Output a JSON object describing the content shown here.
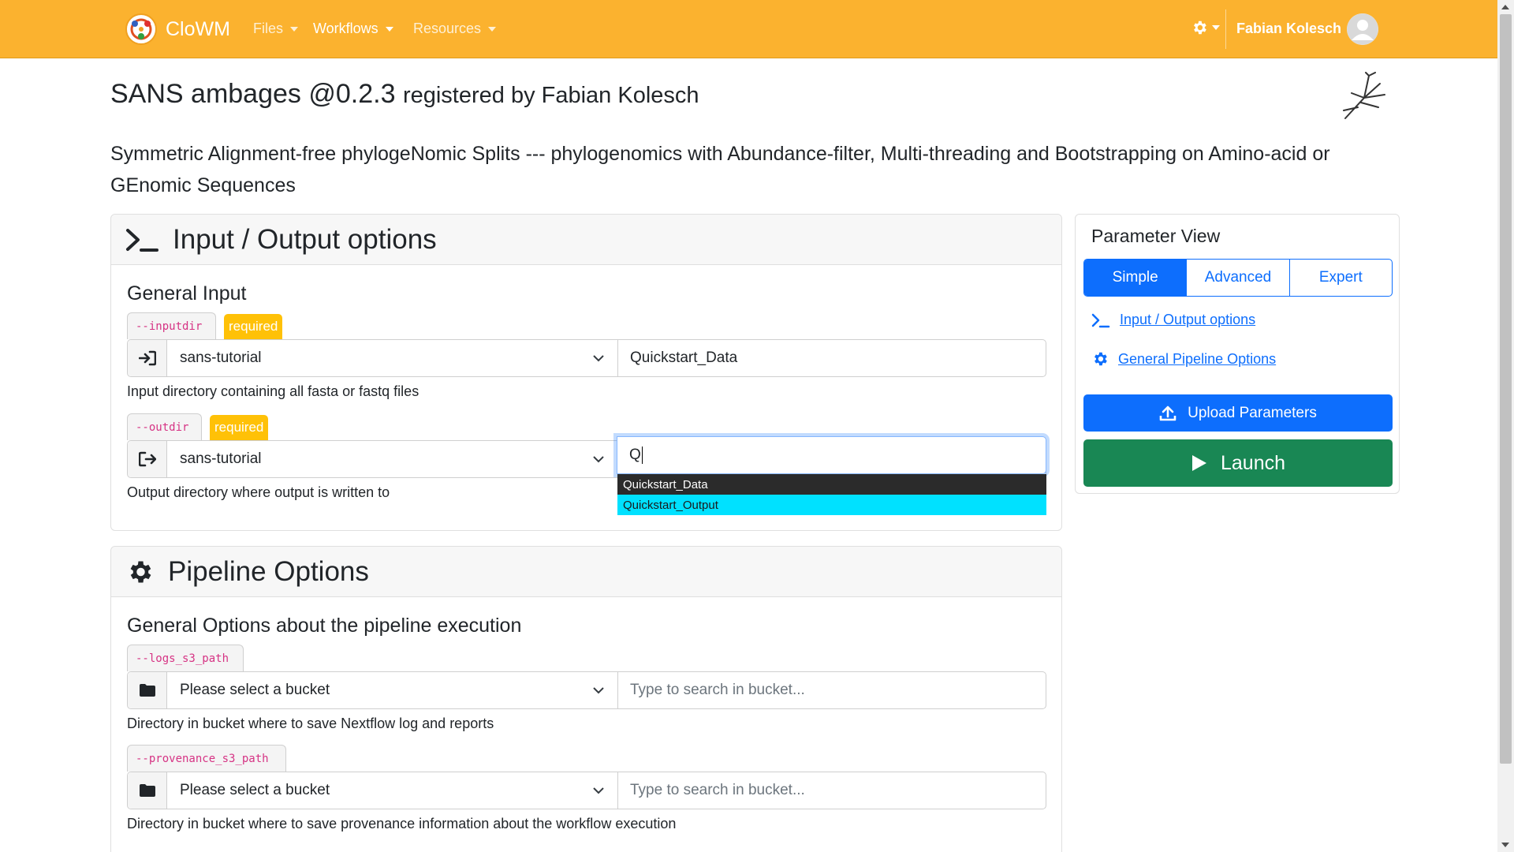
{
  "navbar": {
    "brand": "CloWM",
    "menu": [
      {
        "label": "Files"
      },
      {
        "label": "Workflows"
      },
      {
        "label": "Resources"
      }
    ],
    "user_name": "Fabian Kolesch",
    "icons": {
      "theme": "gear-icon",
      "avatar": "user-avatar-icon"
    },
    "color": "#fbb22f"
  },
  "header": {
    "workflow_name": "SANS ambages @0.2.3",
    "registered_by": "registered by Fabian Kolesch",
    "description": "Symmetric Alignment-free phylogeNomic Splits --- phylogenomics with Abundance-filter, Multi-threading and Bootstrapping on Amino-acid or GEnomic Sequences"
  },
  "io_section": {
    "title": "Input / Output options",
    "icon": "terminal-icon",
    "subtitle": "General Input",
    "params": [
      {
        "flag": "--inputdir",
        "badge": "required",
        "icon": "sign-in-icon",
        "bucket": "sans-tutorial",
        "path": "Quickstart_Data",
        "help": "Input directory containing all fasta or fastq files"
      },
      {
        "flag": "--outdir",
        "badge": "required",
        "icon": "sign-out-icon",
        "bucket": "sans-tutorial",
        "path": "Q",
        "help": "Output directory where output is written to"
      }
    ],
    "autocomplete": [
      "Quickstart_Data",
      "Quickstart_Output"
    ]
  },
  "pipeline_section": {
    "title": "Pipeline Options",
    "icon": "gear-icon",
    "subtitle": "General Options about the pipeline execution",
    "params": [
      {
        "flag": "--logs_s3_path",
        "icon": "folder-icon",
        "bucket": "Please select a bucket",
        "path_placeholder": "Type to search in bucket...",
        "help": "Directory in bucket where to save Nextflow log and reports"
      },
      {
        "flag": "--provenance_s3_path",
        "icon": "folder-icon",
        "bucket": "Please select a bucket",
        "path_placeholder": "Type to search in bucket...",
        "help": "Directory in bucket where to save provenance information about the workflow execution"
      }
    ]
  },
  "side_panel": {
    "title": "Parameter View",
    "view_modes": [
      "Simple",
      "Advanced",
      "Expert"
    ],
    "active_mode": "Simple",
    "links": [
      {
        "label": "Input / Output options",
        "icon": "terminal-icon"
      },
      {
        "label": "General Pipeline Options",
        "icon": "gear-icon"
      }
    ],
    "upload_button": "Upload Parameters",
    "launch_button": "Launch"
  },
  "colors": {
    "primary": "#0d6efd",
    "success": "#198754",
    "warning": "#ffc107",
    "navbar": "#fbb22f",
    "highlight": "#00e1ff"
  }
}
